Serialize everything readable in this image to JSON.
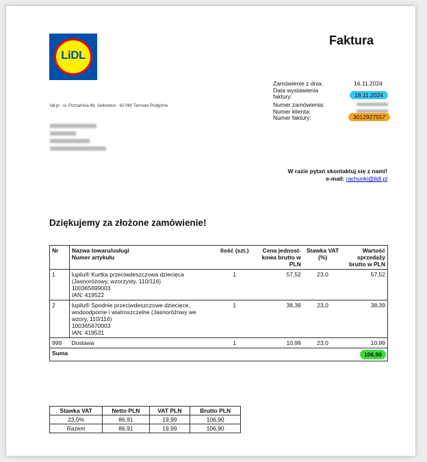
{
  "logo": {
    "text": "LiDL"
  },
  "title": "Faktura",
  "seller_address": "lidl.pl · ul. Poznańska 48, Jankowice · 62-080 Tarnowo Podgórne",
  "meta": {
    "order_date_label": "Zamówienie z dnia:",
    "order_date": "16.11.2024",
    "invoice_date_label_1": "Data wystawienia",
    "invoice_date_label_2": "faktury:",
    "invoice_date": "18.11.2024",
    "order_no_label": "Numer zamówienia:",
    "client_no_label": "Numer klienta:",
    "invoice_no_label": "Numer faktury:",
    "invoice_no": "3012927557"
  },
  "contact": {
    "line1": "W razie pytań skontaktuj się z nami!",
    "email_label": "e-mail:",
    "email": "rachunki@lidl.pl"
  },
  "thanks": "Dziękujemy za złożone zamówienie!",
  "items": {
    "headers": {
      "nr": "Nr",
      "name1": "Nazwa towaru/usługi",
      "name2": "Numer artykułu",
      "qty": "Ilość (szt.)",
      "price": "Cena jednost-kowa brutto w PLN",
      "vat": "Stawka VAT (%)",
      "value": "Wartość sprzedaży brutto w PLN"
    },
    "rows": [
      {
        "nr": "1",
        "name": "lupilu® Kurtka przeciwdeszczowa dziecięca (Jasnoróżowy, wzorzysty, 110/116)",
        "art": "100365699003",
        "ian": "IAN: 419522",
        "qty": "1",
        "price": "57,52",
        "vat": "23,0",
        "value": "57,52"
      },
      {
        "nr": "2",
        "name": "lupilu® Spodnie przeciwdeszczowe dziecięce, wodoodporne i wiatroszczelne (Jasnoróżowy we wzory, 110/116)",
        "art": "100365670003",
        "ian": "IAN: 419531",
        "qty": "1",
        "price": "38,39",
        "vat": "23,0",
        "value": "38,39"
      },
      {
        "nr": "999",
        "name": "Dostawa",
        "art": "",
        "ian": "",
        "qty": "1",
        "price": "10,99",
        "vat": "23,0",
        "value": "10,99"
      }
    ],
    "sum_label": "Suma",
    "sum_value": "106,90"
  },
  "vat_table": {
    "headers": [
      "Stawka VAT",
      "Netto PLN",
      "VAT PLN",
      "Brutto PLN"
    ],
    "rows": [
      [
        "23,0%",
        "86,91",
        "19,99",
        "106,90"
      ],
      [
        "Razem",
        "86,91",
        "19,99",
        "106,90"
      ]
    ]
  },
  "colors": {
    "date_pill": "#3ec6f0",
    "invoice_pill": "#f5a623",
    "sum_pill": "#3fdc3f"
  }
}
